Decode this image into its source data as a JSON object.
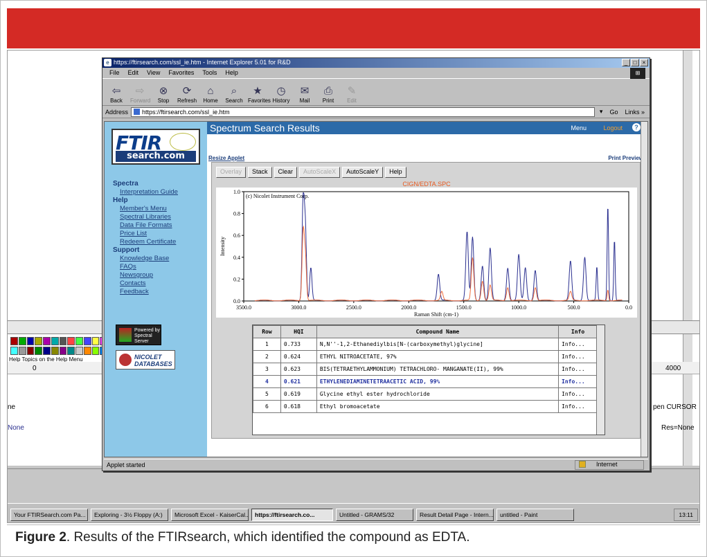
{
  "ie": {
    "title": "https://ftirsearch.com/ssl_ie.htm - Internet Explorer 5.01 for R&D",
    "menu": [
      "File",
      "Edit",
      "View",
      "Favorites",
      "Tools",
      "Help"
    ],
    "toolbar": [
      {
        "label": "Back",
        "icon": "back-arrow-icon",
        "enabled": true
      },
      {
        "label": "Forward",
        "icon": "forward-arrow-icon",
        "enabled": false
      },
      {
        "label": "Stop",
        "icon": "stop-icon",
        "enabled": true
      },
      {
        "label": "Refresh",
        "icon": "refresh-icon",
        "enabled": true
      },
      {
        "label": "Home",
        "icon": "home-icon",
        "enabled": true
      },
      {
        "label": "Search",
        "icon": "search-icon",
        "enabled": true
      },
      {
        "label": "Favorites",
        "icon": "favorites-icon",
        "enabled": true
      },
      {
        "label": "History",
        "icon": "history-icon",
        "enabled": true
      },
      {
        "label": "Mail",
        "icon": "mail-icon",
        "enabled": true
      },
      {
        "label": "Print",
        "icon": "print-icon",
        "enabled": true
      },
      {
        "label": "Edit",
        "icon": "edit-icon",
        "enabled": false
      }
    ],
    "address_label": "Address",
    "address": "https://ftirsearch.com/ssl_ie.htm",
    "go": "Go",
    "links": "Links »",
    "status": "Applet started",
    "zone": "Internet"
  },
  "page": {
    "header": "Spectrum Search Results",
    "menu": "Menu",
    "logout": "Logout",
    "help": "?",
    "resize_link": "Resize Applet",
    "print_link": "Print Preview",
    "sidebar": {
      "logo_top": "FTIR",
      "logo_bottom": "search.com",
      "sections": [
        {
          "heading": "Spectra",
          "links": [
            "Interpretation Guide"
          ]
        },
        {
          "heading": "Help",
          "links": [
            "Member's Menu",
            "Spectral Libraries",
            "Data File Formats",
            "Price List",
            "Redeem Certificate"
          ]
        },
        {
          "heading": "Support",
          "links": [
            "Knowledge Base",
            "FAQs",
            "Newsgroup",
            "Contacts",
            "Feedback"
          ]
        }
      ],
      "badge_powered": "Powered by Spectral Server",
      "badge_nicolet": "NICOLET DATABASES"
    },
    "applet": {
      "buttons": [
        {
          "label": "Overlay",
          "enabled": false
        },
        {
          "label": "Stack",
          "enabled": true
        },
        {
          "label": "Clear",
          "enabled": true
        },
        {
          "label": "AutoScaleX",
          "enabled": false
        },
        {
          "label": "AutoScaleY",
          "enabled": true
        },
        {
          "label": "Help",
          "enabled": true
        }
      ],
      "selected_spectrum": "CIGN/EDTA.SPC"
    },
    "results": {
      "columns": [
        "Row",
        "HQI",
        "Compound Name",
        "Info"
      ],
      "rows": [
        {
          "row": "1",
          "hqi": "0.733",
          "name": "N,N''-1,2-Ethanediylbis[N-(carboxymethyl)glycine]",
          "info": "Info..."
        },
        {
          "row": "2",
          "hqi": "0.624",
          "name": "ETHYL NITROACETATE, 97%",
          "info": "Info..."
        },
        {
          "row": "3",
          "hqi": "0.623",
          "name": "BIS(TETRAETHYLAMMONIUM) TETRACHLORO- MANGANATE(II), 99%",
          "info": "Info..."
        },
        {
          "row": "4",
          "hqi": "0.621",
          "name": "ETHYLENEDIAMINETETRAACETIC ACID, 99%",
          "info": "Info...",
          "highlight": true
        },
        {
          "row": "5",
          "hqi": "0.619",
          "name": "Glycine ethyl ester hydrochloride",
          "info": "Info..."
        },
        {
          "row": "6",
          "hqi": "0.618",
          "name": "Ethyl bromoacetate",
          "info": "Info..."
        }
      ]
    }
  },
  "chart_data": {
    "type": "line",
    "annotation": "(c) Nicolet Instrument Corp.",
    "xlabel": "Raman Shift (cm-1)",
    "ylabel": "Intensity",
    "xlim": [
      3500,
      0
    ],
    "ylim": [
      0,
      1.0
    ],
    "x_ticks": [
      "3500.0",
      "3000.0",
      "2500.0",
      "2000.0",
      "1500.0",
      "1000.0",
      "500.0",
      "0.0"
    ],
    "y_ticks": [
      "0.0",
      "0.2",
      "0.4",
      "0.6",
      "0.8",
      "1.0"
    ],
    "series": [
      {
        "color": "#2a2f8f",
        "peaks": [
          [
            2960,
            0.92
          ],
          [
            2940,
            0.65
          ],
          [
            2890,
            0.3
          ],
          [
            1730,
            0.24
          ],
          [
            1470,
            0.63
          ],
          [
            1420,
            0.58
          ],
          [
            1330,
            0.32
          ],
          [
            1260,
            0.48
          ],
          [
            1100,
            0.3
          ],
          [
            1000,
            0.42
          ],
          [
            940,
            0.3
          ],
          [
            850,
            0.28
          ],
          [
            530,
            0.36
          ],
          [
            400,
            0.4
          ],
          [
            290,
            0.31
          ],
          [
            190,
            0.88
          ],
          [
            130,
            0.56
          ]
        ]
      },
      {
        "color": "#f07040",
        "peaks": [
          [
            2960,
            0.62
          ],
          [
            2940,
            0.4
          ],
          [
            1700,
            0.08
          ],
          [
            1420,
            0.39
          ],
          [
            1330,
            0.18
          ],
          [
            1260,
            0.14
          ],
          [
            1100,
            0.12
          ],
          [
            850,
            0.12
          ],
          [
            530,
            0.08
          ],
          [
            190,
            0.1
          ]
        ]
      }
    ]
  },
  "desktop": {
    "help_topics": "Help Topics on the Help Menu",
    "zero": "0",
    "right_value": "4000",
    "ne": "ne",
    "none_left": "None",
    "cursor": "pen CURSOR",
    "res": "Res=None",
    "palette": [
      "#a00",
      "#0a0",
      "#00a",
      "#aa0",
      "#a0a",
      "#0aa",
      "#555",
      "#f44",
      "#4f4",
      "#44f",
      "#ff4",
      "#f4f",
      "#4ff",
      "#999",
      "#800",
      "#080",
      "#008",
      "#880",
      "#808",
      "#088",
      "#ccc",
      "#f80",
      "#8f0",
      "#08f"
    ]
  },
  "taskbar": {
    "tasks": [
      {
        "label": "Your FTIRSearch.com Pa...",
        "active": false
      },
      {
        "label": "Exploring - 3½ Floppy (A:)",
        "active": false
      },
      {
        "label": "Microsoft Excel - KaiserCal...",
        "active": false
      },
      {
        "label": "https://ftirsearch.co...",
        "active": true
      },
      {
        "label": "Untitled - GRAMS/32",
        "active": false
      },
      {
        "label": "Result Detail Page - Intern...",
        "active": false
      },
      {
        "label": "untitled - Paint",
        "active": false
      }
    ],
    "clock": "13:11"
  },
  "caption": {
    "bold": "Figure 2",
    "text": ". Results of the FTIRsearch, which identified the compound as EDTA."
  }
}
